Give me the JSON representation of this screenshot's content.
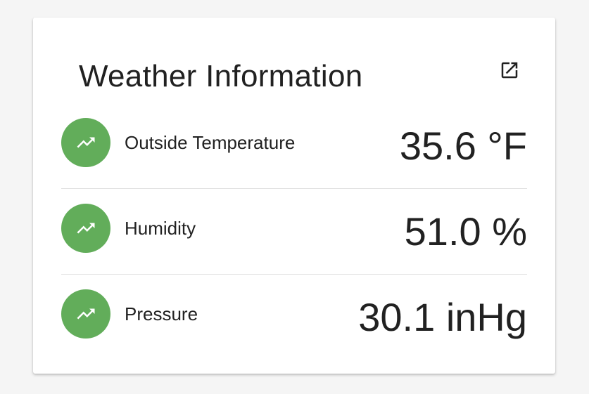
{
  "card": {
    "title": "Weather Information",
    "open_icon": "open-in-new-icon"
  },
  "rows": [
    {
      "icon": "trending-up-icon",
      "label": "Outside Temperature",
      "value": "35.6 °F"
    },
    {
      "icon": "trending-up-icon",
      "label": "Humidity",
      "value": "51.0 %"
    },
    {
      "icon": "trending-up-icon",
      "label": "Pressure",
      "value": "30.1 inHg"
    }
  ],
  "colors": {
    "badge": "#62ad5a",
    "text": "#212121",
    "divider": "#e0e0e0",
    "background": "#f5f5f5"
  }
}
